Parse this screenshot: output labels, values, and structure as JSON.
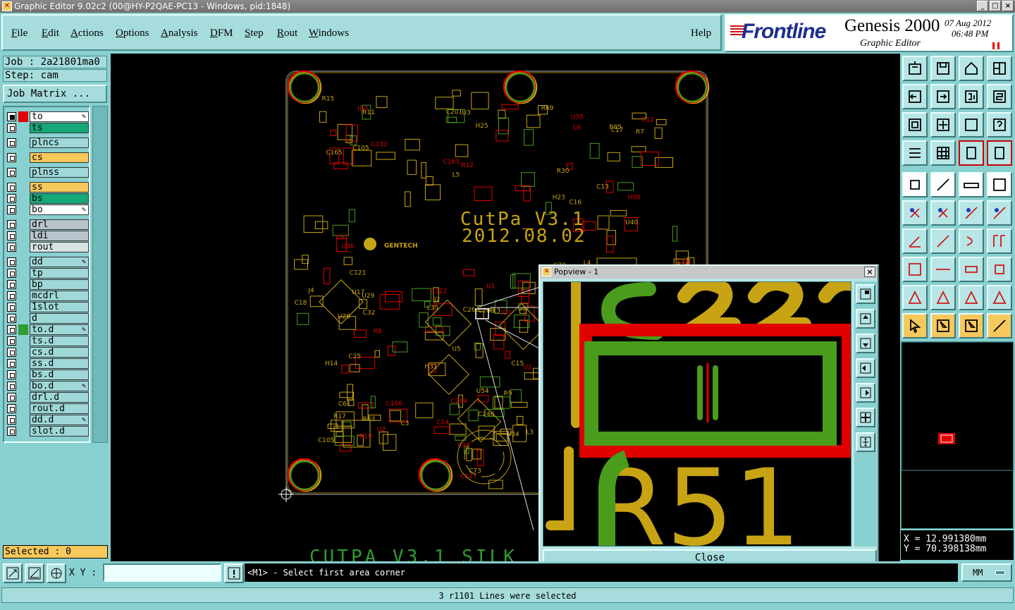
{
  "window": {
    "title": "Graphic Editor 9.02c2 (00@HY-P2QAE-PC13 - Windows, pid:1848)",
    "buttons": [
      "_",
      "□",
      "×"
    ]
  },
  "menu": {
    "items": [
      {
        "label": "File",
        "u": "F",
        "rest": "ile"
      },
      {
        "label": "Edit",
        "u": "E",
        "rest": "dit"
      },
      {
        "label": "Actions",
        "u": "A",
        "rest": "ctions"
      },
      {
        "label": "Options",
        "u": "O",
        "rest": "ptions"
      },
      {
        "label": "Analysis",
        "u": "A",
        "rest": "nalysis"
      },
      {
        "label": "DFM",
        "u": "D",
        "rest": "FM"
      },
      {
        "label": "Step",
        "u": "S",
        "rest": "tep"
      },
      {
        "label": "Rout",
        "u": "R",
        "rest": "out"
      },
      {
        "label": "Windows",
        "u": "W",
        "rest": "indows"
      }
    ],
    "help": "Help"
  },
  "brand": {
    "logo": "Frontline",
    "product": "Genesis 2000",
    "subtitle": "Graphic Editor",
    "date": "07 Aug 2012",
    "time": "06:48 PM"
  },
  "job": {
    "job_label": "Job : 2a21801ma0",
    "step_label": "Step: cam",
    "matrix_button": "Job Matrix ..."
  },
  "layers": [
    {
      "name": "to",
      "color": "#ffffff",
      "swatch": "#e00000",
      "checked": true,
      "mark": "✎"
    },
    {
      "name": "ts",
      "color": "#16a878",
      "swatch": "",
      "checked": false,
      "mark": ""
    },
    {
      "name": "plncs",
      "color": "#9fd8d8",
      "swatch": "",
      "checked": false,
      "mark": ""
    },
    {
      "name": "cs",
      "color": "#f7c85c",
      "swatch": "",
      "checked": false,
      "mark": ""
    },
    {
      "name": "plnss",
      "color": "#9fd8d8",
      "swatch": "",
      "checked": false,
      "mark": ""
    },
    {
      "name": "ss",
      "color": "#f7c85c",
      "swatch": "",
      "checked": false,
      "mark": ""
    },
    {
      "name": "bs",
      "color": "#16a878",
      "swatch": "",
      "checked": false,
      "mark": ""
    },
    {
      "name": "bo",
      "color": "#ffffff",
      "swatch": "",
      "checked": false,
      "mark": "✎"
    },
    {
      "name": "drl",
      "color": "#b8c4cc",
      "swatch": "",
      "checked": false,
      "mark": ""
    },
    {
      "name": "ldi",
      "color": "#b8c4cc",
      "swatch": "",
      "checked": false,
      "mark": ""
    },
    {
      "name": "rout",
      "color": "#d8e4e4",
      "swatch": "",
      "checked": false,
      "mark": ""
    },
    {
      "name": "dd",
      "color": "#9fd8d8",
      "swatch": "",
      "checked": false,
      "mark": "✎"
    },
    {
      "name": "tp",
      "color": "#9fd8d8",
      "swatch": "",
      "checked": false,
      "mark": ""
    },
    {
      "name": "bp",
      "color": "#9fd8d8",
      "swatch": "",
      "checked": false,
      "mark": ""
    },
    {
      "name": "mcdrl",
      "color": "#9fd8d8",
      "swatch": "",
      "checked": false,
      "mark": ""
    },
    {
      "name": "1slot",
      "color": "#9fd8d8",
      "swatch": "",
      "checked": false,
      "mark": ""
    },
    {
      "name": "d",
      "color": "#9fd8d8",
      "swatch": "",
      "checked": false,
      "mark": ""
    },
    {
      "name": "to.d",
      "color": "#9fd8d8",
      "swatch": "#2e9e2e",
      "checked": false,
      "mark": "✎"
    },
    {
      "name": "ts.d",
      "color": "#9fd8d8",
      "swatch": "",
      "checked": false,
      "mark": ""
    },
    {
      "name": "cs.d",
      "color": "#9fd8d8",
      "swatch": "",
      "checked": false,
      "mark": ""
    },
    {
      "name": "ss.d",
      "color": "#9fd8d8",
      "swatch": "",
      "checked": false,
      "mark": ""
    },
    {
      "name": "bs.d",
      "color": "#9fd8d8",
      "swatch": "",
      "checked": false,
      "mark": ""
    },
    {
      "name": "bo.d",
      "color": "#9fd8d8",
      "swatch": "",
      "checked": false,
      "mark": "✎"
    },
    {
      "name": "drl.d",
      "color": "#9fd8d8",
      "swatch": "",
      "checked": false,
      "mark": ""
    },
    {
      "name": "rout.d",
      "color": "#9fd8d8",
      "swatch": "",
      "checked": false,
      "mark": ""
    },
    {
      "name": "dd.d",
      "color": "#9fd8d8",
      "swatch": "",
      "checked": false,
      "mark": "✎"
    },
    {
      "name": "slot.d",
      "color": "#9fd8d8",
      "swatch": "",
      "checked": false,
      "mark": ""
    }
  ],
  "selected": "Selected : 0",
  "board": {
    "title": "CutPa_V3.1",
    "date": "2012.08.02",
    "bottom_text": "CUTPA V3.1  SILK",
    "logo_text": "GENTECH",
    "refs": [
      "ID3",
      "H25",
      "H23",
      "H30",
      "J4",
      "J2",
      "ID1",
      "C70",
      "C105",
      "C14",
      "C15",
      "L4",
      "U2",
      "C73",
      "R11",
      "R12",
      "C16",
      "C13",
      "C31",
      "C32",
      "C26",
      "U4",
      "C25",
      "U5",
      "C30",
      "R16",
      "R17",
      "R18",
      "R15",
      "U3",
      "U35",
      "C17",
      "C18",
      "R8",
      "R13",
      "R10",
      "R19",
      "R9",
      "U34",
      "C58",
      "C61",
      "C246",
      "C132",
      "C201",
      "R30",
      "C12",
      "U28",
      "U29",
      "U1",
      "C2",
      "C3",
      "C264",
      "L3",
      "U40",
      "C166",
      "U54",
      "C165",
      "C163",
      "R69",
      "R85",
      "U36",
      "U17",
      "L35",
      "U12",
      "H14",
      "H31",
      "U2",
      "J5",
      "R63",
      "C127",
      "C105",
      "L5",
      "L6",
      "R7",
      "C121",
      "C122",
      "C209"
    ]
  },
  "popview": {
    "title": "Popview - 1",
    "close_label": "Close",
    "zoom_ref": "R51"
  },
  "coords": {
    "x": "X = 12.991380mm",
    "y": "Y = 70.398138mm"
  },
  "bottom": {
    "xy_label": "X Y :",
    "xy_value": "",
    "prompt": "<M1> - Select first area corner",
    "units": "MM"
  },
  "status": "3 r1101 Lines were selected",
  "colors": {
    "panel": "#89d0d0",
    "silk": "#c8a414",
    "copper": "#4a9c1c",
    "highlight": "#e00000"
  }
}
